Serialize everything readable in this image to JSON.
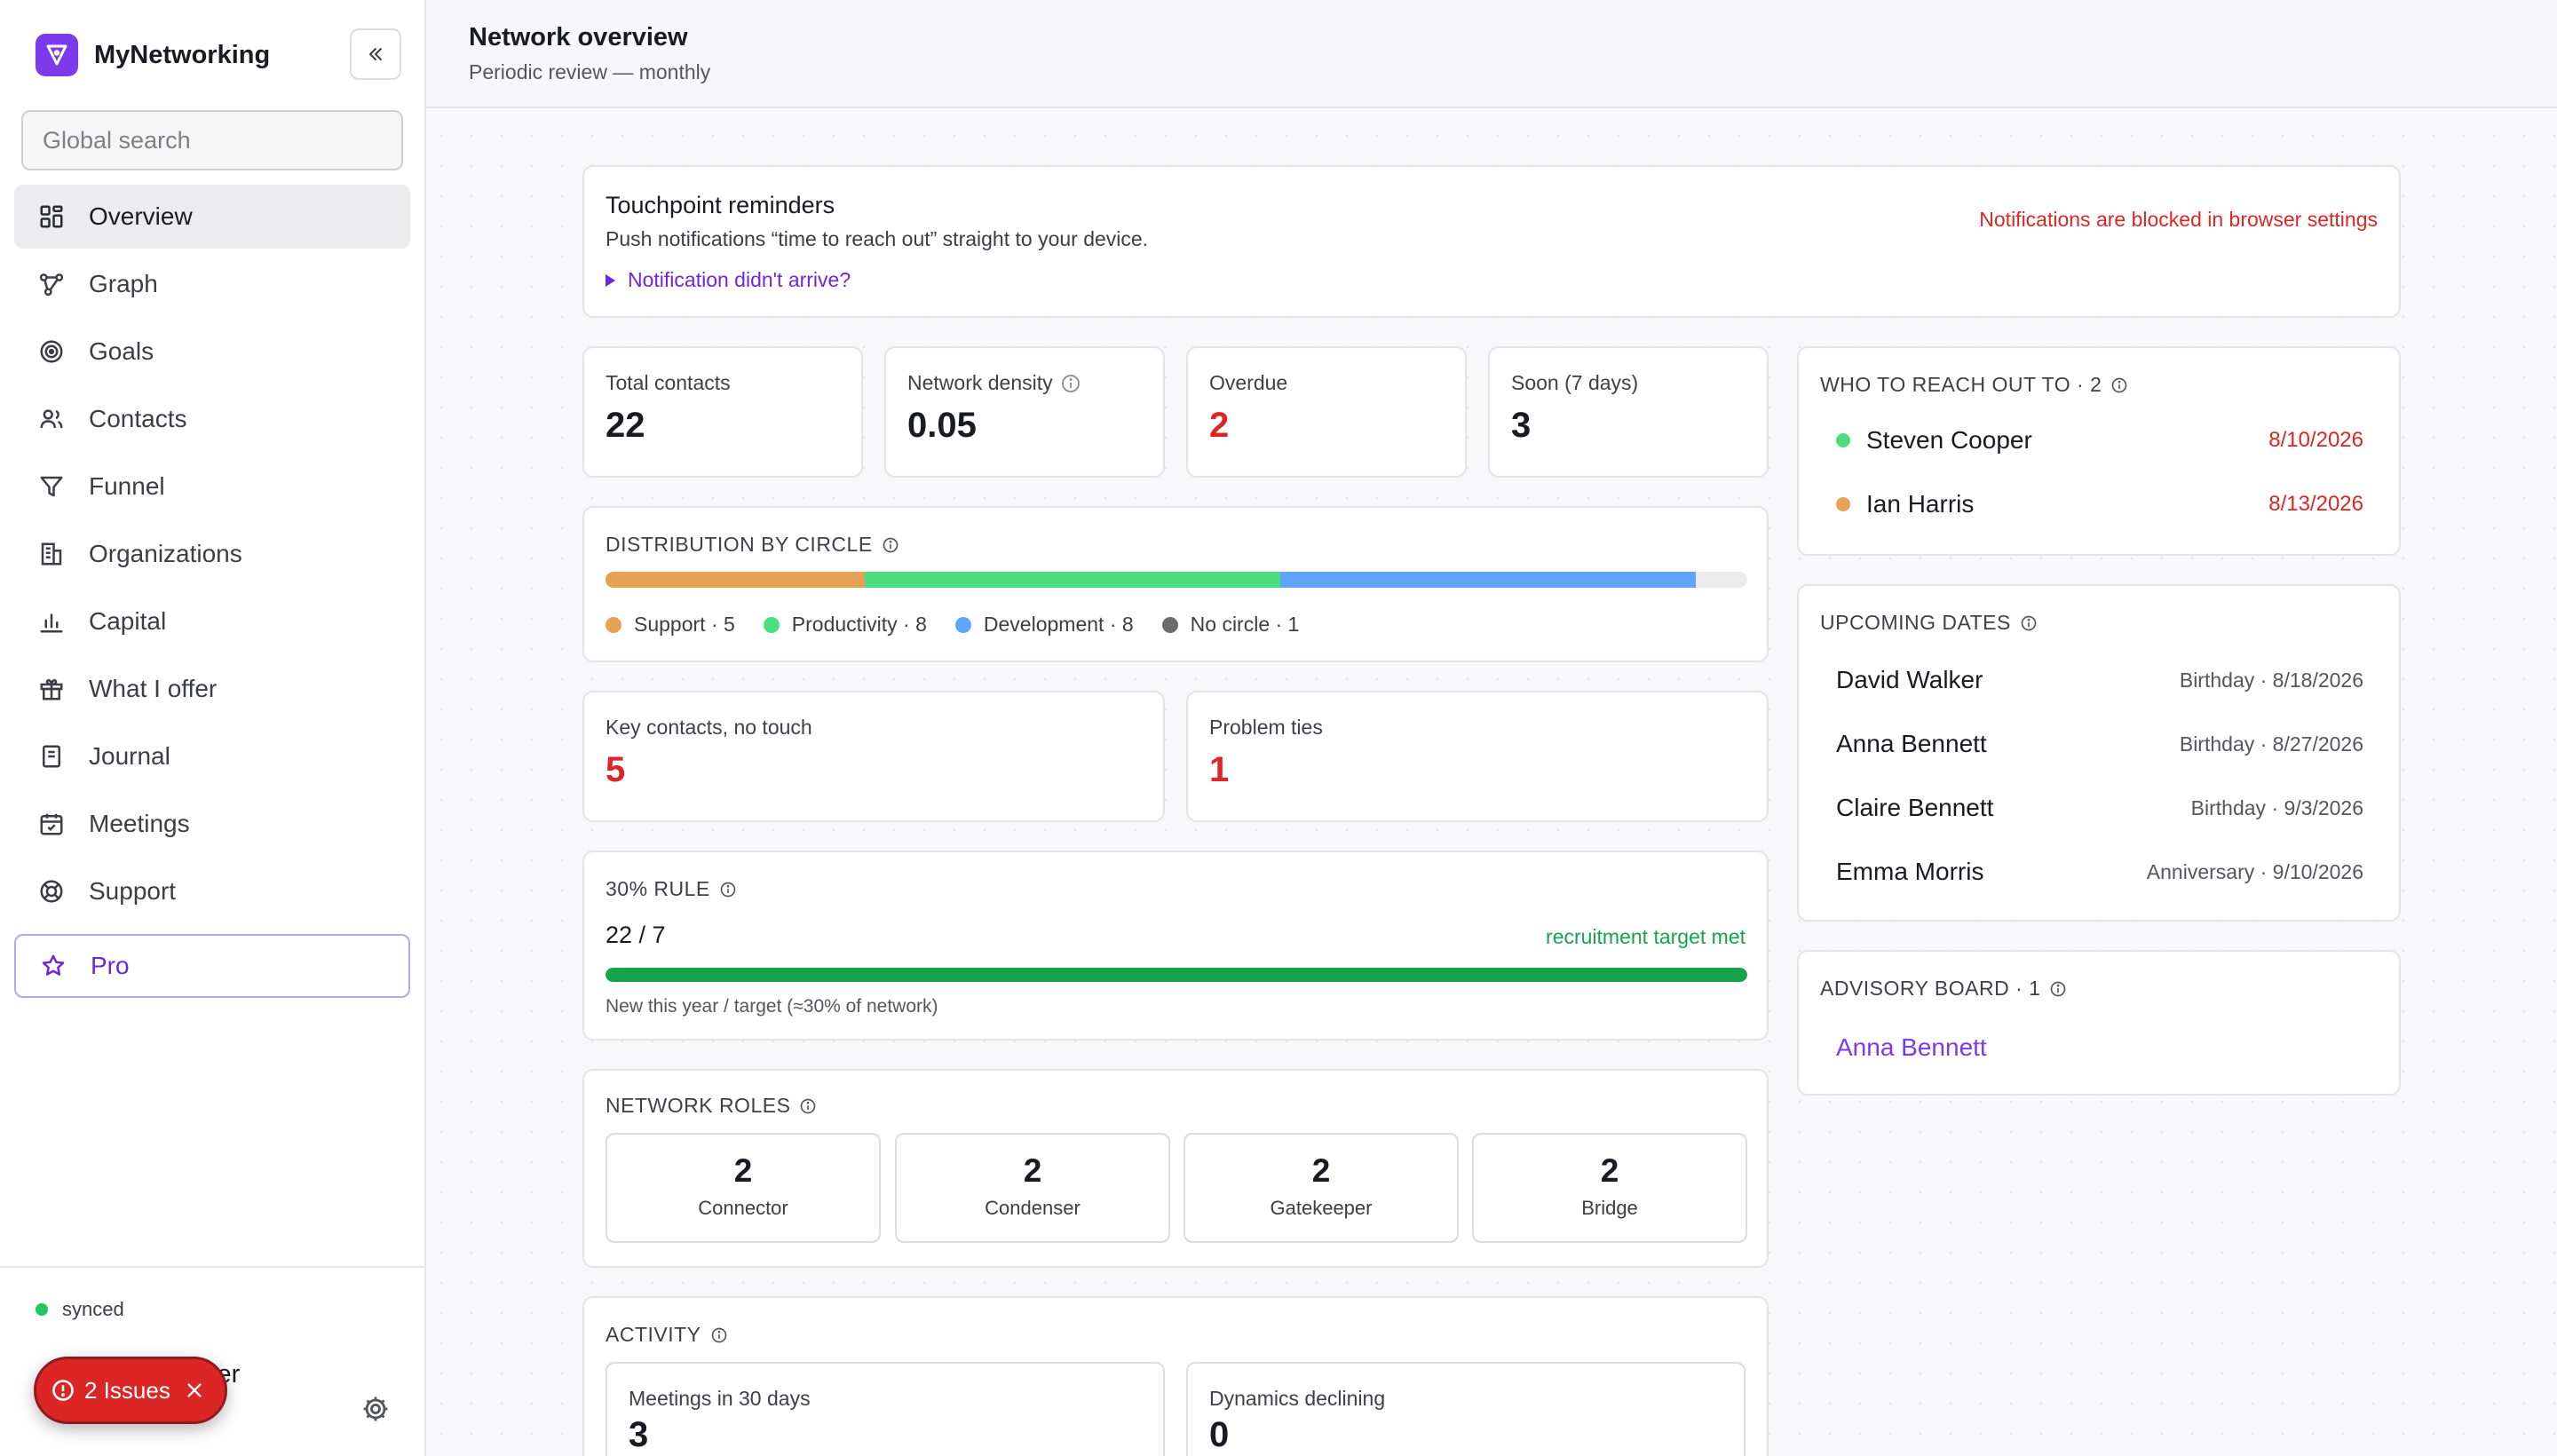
{
  "app": {
    "name": "MyNetworking"
  },
  "sidebar": {
    "search_placeholder": "Global search",
    "items": [
      {
        "label": "Overview",
        "icon": "grid-icon"
      },
      {
        "label": "Graph",
        "icon": "graph-icon"
      },
      {
        "label": "Goals",
        "icon": "target-icon"
      },
      {
        "label": "Contacts",
        "icon": "users-icon"
      },
      {
        "label": "Funnel",
        "icon": "funnel-icon"
      },
      {
        "label": "Organizations",
        "icon": "building-icon"
      },
      {
        "label": "Capital",
        "icon": "bar-chart-icon"
      },
      {
        "label": "What I offer",
        "icon": "gift-icon"
      },
      {
        "label": "Journal",
        "icon": "notebook-icon"
      },
      {
        "label": "Meetings",
        "icon": "calendar-icon"
      },
      {
        "label": "Support",
        "icon": "lifebuoy-icon"
      },
      {
        "label": "Pro",
        "icon": "star-icon"
      }
    ],
    "sync_status": "synced",
    "user_name_partial": "ser",
    "issues_label": "2 Issues"
  },
  "header": {
    "title": "Network overview",
    "subtitle": "Periodic review — monthly"
  },
  "touchpoint": {
    "title": "Touchpoint reminders",
    "description": "Push notifications “time to reach out” straight to your device.",
    "help_link": "Notification didn't arrive?",
    "warning": "Notifications are blocked in browser settings"
  },
  "stats": {
    "total_contacts": {
      "label": "Total contacts",
      "value": "22"
    },
    "network_density": {
      "label": "Network density",
      "value": "0.05"
    },
    "overdue": {
      "label": "Overdue",
      "value": "2"
    },
    "soon": {
      "label": "Soon (7 days)",
      "value": "3"
    }
  },
  "distribution": {
    "title": "DISTRIBUTION BY CIRCLE",
    "segments": [
      {
        "label": "Support · 5",
        "count": 5,
        "color": "#e5a254"
      },
      {
        "label": "Productivity · 8",
        "count": 8,
        "color": "#4ade80"
      },
      {
        "label": "Development · 8",
        "count": 8,
        "color": "#60a5fa"
      },
      {
        "label": "No circle · 1",
        "count": 1,
        "color": "#6b6b70"
      }
    ],
    "bar_fraction": 0.955
  },
  "key_contacts": {
    "label": "Key contacts, no touch",
    "value": "5"
  },
  "problem_ties": {
    "label": "Problem ties",
    "value": "1"
  },
  "rule": {
    "title": "30% RULE",
    "value": "22 / 7",
    "status": "recruitment target met",
    "progress": 1.0,
    "caption": "New this year / target (≈30% of network)"
  },
  "roles": {
    "title": "NETWORK ROLES",
    "items": [
      {
        "value": "2",
        "label": "Connector"
      },
      {
        "value": "2",
        "label": "Condenser"
      },
      {
        "value": "2",
        "label": "Gatekeeper"
      },
      {
        "value": "2",
        "label": "Bridge"
      }
    ]
  },
  "activity": {
    "title": "ACTIVITY",
    "meetings": {
      "label": "Meetings in 30 days",
      "value": "3"
    },
    "dynamics": {
      "label": "Dynamics declining",
      "value": "0"
    }
  },
  "reach_out": {
    "title": "WHO TO REACH OUT TO · 2",
    "people": [
      {
        "name": "Steven Cooper",
        "date": "8/10/2026",
        "color": "#4ade80"
      },
      {
        "name": "Ian Harris",
        "date": "8/13/2026",
        "color": "#e5a254"
      }
    ]
  },
  "upcoming": {
    "title": "UPCOMING DATES",
    "items": [
      {
        "name": "David Walker",
        "detail": "Birthday · 8/18/2026"
      },
      {
        "name": "Anna Bennett",
        "detail": "Birthday · 8/27/2026"
      },
      {
        "name": "Claire Bennett",
        "detail": "Birthday · 9/3/2026"
      },
      {
        "name": "Emma Morris",
        "detail": "Anniversary · 9/10/2026"
      }
    ]
  },
  "advisory": {
    "title": "ADVISORY BOARD · 1",
    "member": "Anna Bennett"
  },
  "colors": {
    "accent": "#7c3aed",
    "danger": "#dc2626",
    "success": "#16a34a"
  }
}
